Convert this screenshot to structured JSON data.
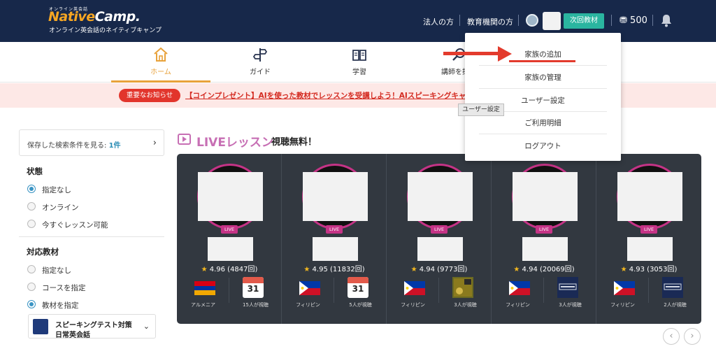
{
  "header": {
    "logo_small": "オンライン英会話",
    "logo_native": "Native",
    "logo_camp": "Camp.",
    "logo_sub": "オンライン英会話のネイティブキャンプ",
    "link_corporate": "法人の方",
    "link_education": "教育機関の方",
    "next_material_btn": "次回教材",
    "coins": "500"
  },
  "nav": {
    "home": "ホーム",
    "guide": "ガイド",
    "study": "学習",
    "find_teacher": "講師を探す"
  },
  "notice": {
    "badge": "重要なお知らせ",
    "text": "【コインプレゼント】AIを使った教材でレッスンを受講しよう！AIスピーキングキャン"
  },
  "sidebar": {
    "saved_label": "保存した検索条件を見る:",
    "saved_count": "1件",
    "status_heading": "状態",
    "status_options": [
      "指定なし",
      "オンライン",
      "今すぐレッスン可能"
    ],
    "material_heading": "対応教材",
    "material_options": [
      "指定なし",
      "コースを指定",
      "教材を指定"
    ],
    "material_line1": "スピーキングテスト対策",
    "material_line2": "日常英会話"
  },
  "live": {
    "title": "LIVEレッスン",
    "subtitle": "視聴無料！",
    "badge": "LIVE",
    "cards": [
      {
        "rating": "4.96 (4847回)",
        "country": "アルメニア",
        "viewers": "15人が視聴",
        "cal_num": "31"
      },
      {
        "rating": "4.95 (11832回)",
        "country": "フィリピン",
        "viewers": "5人が視聴",
        "cal_num": "31"
      },
      {
        "rating": "4.94 (9773回)",
        "country": "フィリピン",
        "viewers": "3人が視聴",
        "cal_num": ""
      },
      {
        "rating": "4.94 (20069回)",
        "country": "フィリピン",
        "viewers": "3人が視聴",
        "cal_num": ""
      },
      {
        "rating": "4.93 (3053回)",
        "country": "フィリピン",
        "viewers": "2人が視聴",
        "cal_num": ""
      }
    ]
  },
  "dropdown": {
    "items": [
      "家族の追加",
      "家族の管理",
      "ユーザー設定",
      "ご利用明細",
      "ログアウト"
    ],
    "tooltip": "ユーザー設定"
  },
  "colors": {
    "header_bg": "#17284a",
    "accent_orange": "#e8a23b",
    "live_pink": "#c76fb4",
    "teal_button": "#2ab5a0",
    "notice_red": "#e2352c",
    "annotation_red": "#e33b2d"
  }
}
